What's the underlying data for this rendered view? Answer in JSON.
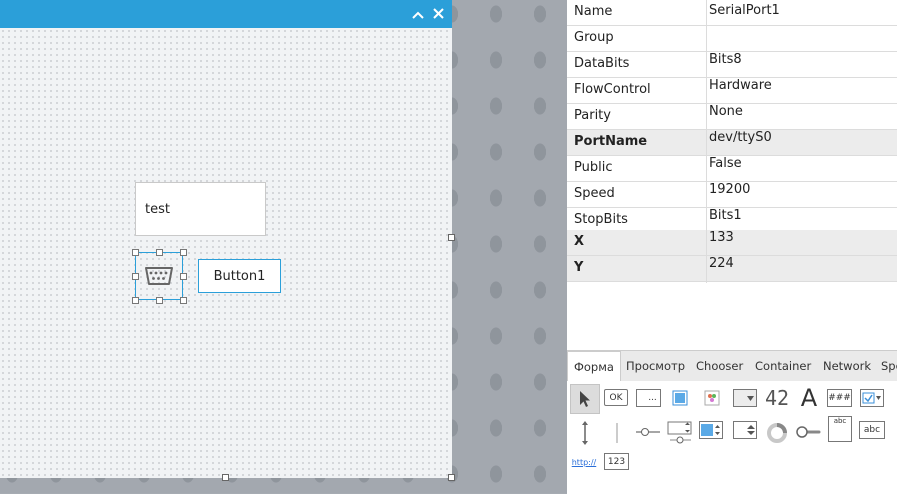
{
  "form": {
    "title_buttons": {
      "maximize": "^",
      "close": "✕"
    },
    "textarea_text": "test",
    "button_label": "Button1"
  },
  "properties": [
    {
      "name": "Name",
      "value": "SerialPort1",
      "bold": false
    },
    {
      "name": "Group",
      "value": "",
      "bold": false
    },
    {
      "name": "DataBits",
      "value": "Bits8",
      "bold": false
    },
    {
      "name": "FlowControl",
      "value": "Hardware",
      "bold": false
    },
    {
      "name": "Parity",
      "value": "None",
      "bold": false
    },
    {
      "name": "PortName",
      "value": "dev/ttyS0",
      "bold": true
    },
    {
      "name": "Public",
      "value": "False",
      "bold": false
    },
    {
      "name": "Speed",
      "value": "19200",
      "bold": false
    },
    {
      "name": "StopBits",
      "value": "Bits1",
      "bold": false
    },
    {
      "name": "X",
      "value": "133",
      "bold": true
    },
    {
      "name": "Y",
      "value": "224",
      "bold": true
    }
  ],
  "toolbox": {
    "tabs": [
      "Форма",
      "Просмотр",
      "Chooser",
      "Container",
      "Network",
      "Spe"
    ],
    "active_tab": "Форма",
    "tools": {
      "ok_label": "OK",
      "dots_label": "...",
      "number_label": "42",
      "label_label": "A",
      "mask_label": "###",
      "abc_label": "abc",
      "link_label": "http://",
      "value_label": "123"
    }
  }
}
